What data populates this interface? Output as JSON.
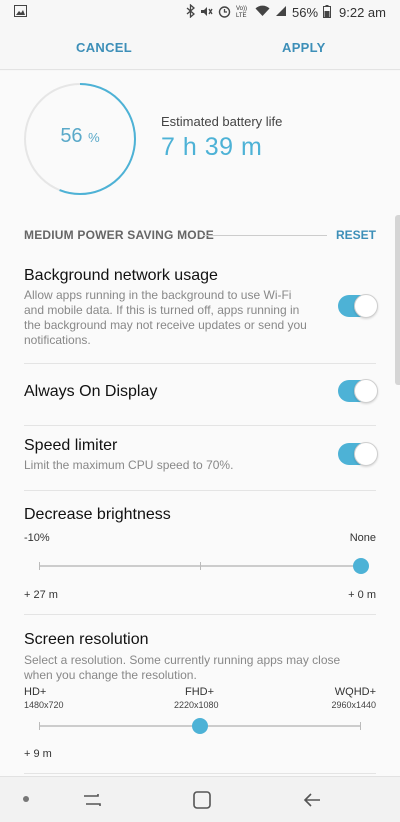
{
  "status": {
    "battery_percent": "56%",
    "time": "9:22 am",
    "volte": "Vo)) LTE",
    "icons": [
      "image-icon",
      "bluetooth-icon",
      "mute-icon",
      "alarm-icon",
      "volte-icon",
      "wifi-icon",
      "signal-icon",
      "battery-icon"
    ]
  },
  "toolbar": {
    "cancel_label": "CANCEL",
    "apply_label": "APPLY"
  },
  "battery": {
    "percent_value": "56",
    "percent_sign": "%",
    "level": 0.56,
    "estimate_label": "Estimated battery life",
    "estimate_value": "7 h 39 m"
  },
  "mode": {
    "title": "MEDIUM POWER SAVING MODE",
    "reset_label": "RESET"
  },
  "settings": [
    {
      "title": "Background network usage",
      "desc": "Allow apps running in the background to use Wi-Fi and mobile data. If this is turned off, apps running in the background may not receive updates or send you notifications.",
      "enabled": true
    },
    {
      "title": "Always On Display",
      "enabled": true
    },
    {
      "title": "Speed limiter",
      "desc": "Limit the maximum CPU speed to 70%.",
      "enabled": true
    }
  ],
  "brightness": {
    "title": "Decrease brightness",
    "left_label": "-10%",
    "right_label": "None",
    "left_time": "+ 27 m",
    "right_time": "+ 0 m",
    "selected": "None"
  },
  "resolution": {
    "title": "Screen resolution",
    "desc": "Select a resolution. Some currently running apps may close when you change the resolution.",
    "options": [
      {
        "name": "HD+",
        "size": "1480x720"
      },
      {
        "name": "FHD+",
        "size": "2220x1080"
      },
      {
        "name": "WQHD+",
        "size": "2960x1440"
      }
    ],
    "selected": "FHD+",
    "time": "+ 9 m"
  },
  "colors": {
    "accent": "#4db2d6",
    "button_text": "#3d8fb8"
  },
  "nav": {
    "icons": [
      "recent-apps-icon",
      "home-icon",
      "back-icon"
    ]
  }
}
